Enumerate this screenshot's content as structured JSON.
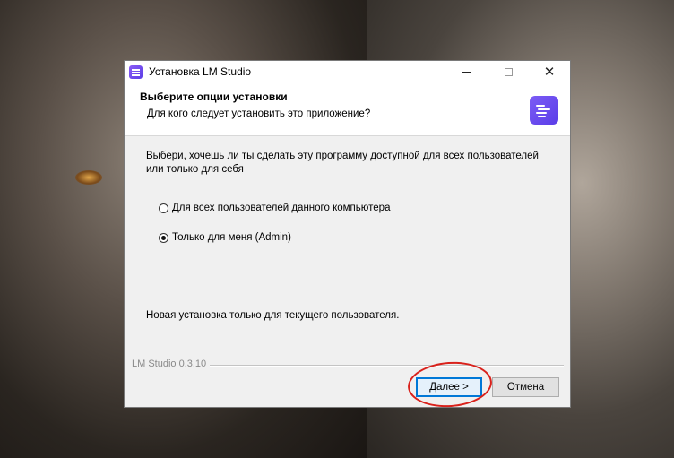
{
  "window": {
    "title": "Установка LM Studio",
    "controls": {
      "minimize": "minimize",
      "maximize": "maximize",
      "close": "✕"
    }
  },
  "header": {
    "title": "Выберите опции установки",
    "subtitle": "Для кого следует установить это приложение?"
  },
  "body": {
    "description": "Выбери, хочешь ли ты сделать эту программу доступной для всех пользователей или только для себя",
    "options": [
      {
        "label": "Для всех пользователей данного компьютера",
        "selected": false
      },
      {
        "label": "Только для меня (Admin)",
        "selected": true
      }
    ],
    "status": "Новая установка только для текущего пользователя."
  },
  "footer": {
    "version": "LM Studio 0.3.10",
    "next_label": "Далее >",
    "cancel_label": "Отмена"
  },
  "icons": {
    "app": "lm-studio-icon",
    "colors": {
      "accent": "#0078d7",
      "logo": "#6b4ef0",
      "annotation": "#d9221c"
    }
  }
}
